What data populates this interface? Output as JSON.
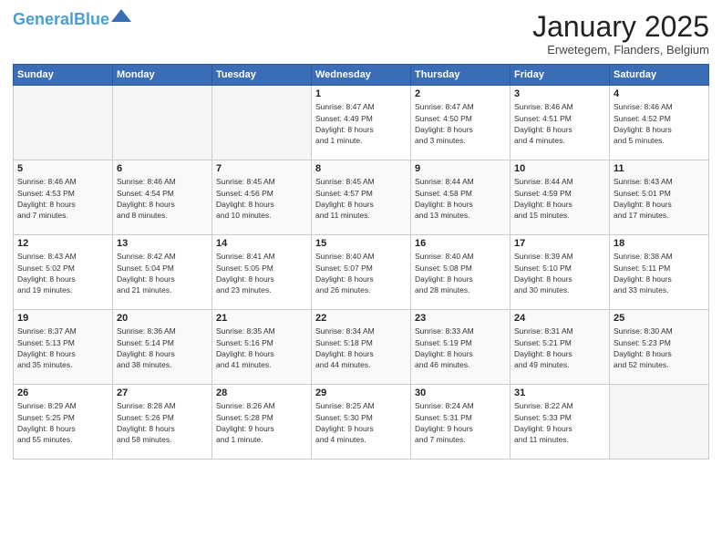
{
  "header": {
    "logo_general": "General",
    "logo_blue": "Blue",
    "month_title": "January 2025",
    "location": "Erwetegem, Flanders, Belgium"
  },
  "days_of_week": [
    "Sunday",
    "Monday",
    "Tuesday",
    "Wednesday",
    "Thursday",
    "Friday",
    "Saturday"
  ],
  "weeks": [
    {
      "days": [
        {
          "num": "",
          "info": ""
        },
        {
          "num": "",
          "info": ""
        },
        {
          "num": "",
          "info": ""
        },
        {
          "num": "1",
          "info": "Sunrise: 8:47 AM\nSunset: 4:49 PM\nDaylight: 8 hours\nand 1 minute."
        },
        {
          "num": "2",
          "info": "Sunrise: 8:47 AM\nSunset: 4:50 PM\nDaylight: 8 hours\nand 3 minutes."
        },
        {
          "num": "3",
          "info": "Sunrise: 8:46 AM\nSunset: 4:51 PM\nDaylight: 8 hours\nand 4 minutes."
        },
        {
          "num": "4",
          "info": "Sunrise: 8:46 AM\nSunset: 4:52 PM\nDaylight: 8 hours\nand 5 minutes."
        }
      ]
    },
    {
      "days": [
        {
          "num": "5",
          "info": "Sunrise: 8:46 AM\nSunset: 4:53 PM\nDaylight: 8 hours\nand 7 minutes."
        },
        {
          "num": "6",
          "info": "Sunrise: 8:46 AM\nSunset: 4:54 PM\nDaylight: 8 hours\nand 8 minutes."
        },
        {
          "num": "7",
          "info": "Sunrise: 8:45 AM\nSunset: 4:56 PM\nDaylight: 8 hours\nand 10 minutes."
        },
        {
          "num": "8",
          "info": "Sunrise: 8:45 AM\nSunset: 4:57 PM\nDaylight: 8 hours\nand 11 minutes."
        },
        {
          "num": "9",
          "info": "Sunrise: 8:44 AM\nSunset: 4:58 PM\nDaylight: 8 hours\nand 13 minutes."
        },
        {
          "num": "10",
          "info": "Sunrise: 8:44 AM\nSunset: 4:59 PM\nDaylight: 8 hours\nand 15 minutes."
        },
        {
          "num": "11",
          "info": "Sunrise: 8:43 AM\nSunset: 5:01 PM\nDaylight: 8 hours\nand 17 minutes."
        }
      ]
    },
    {
      "days": [
        {
          "num": "12",
          "info": "Sunrise: 8:43 AM\nSunset: 5:02 PM\nDaylight: 8 hours\nand 19 minutes."
        },
        {
          "num": "13",
          "info": "Sunrise: 8:42 AM\nSunset: 5:04 PM\nDaylight: 8 hours\nand 21 minutes."
        },
        {
          "num": "14",
          "info": "Sunrise: 8:41 AM\nSunset: 5:05 PM\nDaylight: 8 hours\nand 23 minutes."
        },
        {
          "num": "15",
          "info": "Sunrise: 8:40 AM\nSunset: 5:07 PM\nDaylight: 8 hours\nand 26 minutes."
        },
        {
          "num": "16",
          "info": "Sunrise: 8:40 AM\nSunset: 5:08 PM\nDaylight: 8 hours\nand 28 minutes."
        },
        {
          "num": "17",
          "info": "Sunrise: 8:39 AM\nSunset: 5:10 PM\nDaylight: 8 hours\nand 30 minutes."
        },
        {
          "num": "18",
          "info": "Sunrise: 8:38 AM\nSunset: 5:11 PM\nDaylight: 8 hours\nand 33 minutes."
        }
      ]
    },
    {
      "days": [
        {
          "num": "19",
          "info": "Sunrise: 8:37 AM\nSunset: 5:13 PM\nDaylight: 8 hours\nand 35 minutes."
        },
        {
          "num": "20",
          "info": "Sunrise: 8:36 AM\nSunset: 5:14 PM\nDaylight: 8 hours\nand 38 minutes."
        },
        {
          "num": "21",
          "info": "Sunrise: 8:35 AM\nSunset: 5:16 PM\nDaylight: 8 hours\nand 41 minutes."
        },
        {
          "num": "22",
          "info": "Sunrise: 8:34 AM\nSunset: 5:18 PM\nDaylight: 8 hours\nand 44 minutes."
        },
        {
          "num": "23",
          "info": "Sunrise: 8:33 AM\nSunset: 5:19 PM\nDaylight: 8 hours\nand 46 minutes."
        },
        {
          "num": "24",
          "info": "Sunrise: 8:31 AM\nSunset: 5:21 PM\nDaylight: 8 hours\nand 49 minutes."
        },
        {
          "num": "25",
          "info": "Sunrise: 8:30 AM\nSunset: 5:23 PM\nDaylight: 8 hours\nand 52 minutes."
        }
      ]
    },
    {
      "days": [
        {
          "num": "26",
          "info": "Sunrise: 8:29 AM\nSunset: 5:25 PM\nDaylight: 8 hours\nand 55 minutes."
        },
        {
          "num": "27",
          "info": "Sunrise: 8:28 AM\nSunset: 5:26 PM\nDaylight: 8 hours\nand 58 minutes."
        },
        {
          "num": "28",
          "info": "Sunrise: 8:26 AM\nSunset: 5:28 PM\nDaylight: 9 hours\nand 1 minute."
        },
        {
          "num": "29",
          "info": "Sunrise: 8:25 AM\nSunset: 5:30 PM\nDaylight: 9 hours\nand 4 minutes."
        },
        {
          "num": "30",
          "info": "Sunrise: 8:24 AM\nSunset: 5:31 PM\nDaylight: 9 hours\nand 7 minutes."
        },
        {
          "num": "31",
          "info": "Sunrise: 8:22 AM\nSunset: 5:33 PM\nDaylight: 9 hours\nand 11 minutes."
        },
        {
          "num": "",
          "info": ""
        }
      ]
    }
  ]
}
